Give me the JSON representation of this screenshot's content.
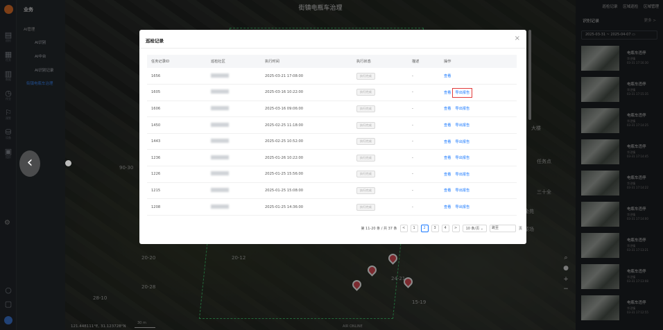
{
  "app": {
    "nav_title": "业务",
    "nav_rail": [
      "巡检",
      "任务",
      "数据",
      "作业",
      "预警",
      "设备",
      "组织",
      "日志"
    ],
    "menu_group": "AI管理",
    "menu_items": [
      "AI识别",
      "AI中台",
      "AI识别记录",
      "街镇电瓶车治理"
    ]
  },
  "map": {
    "title": "街镇电瓶车治理",
    "labels": [
      "90-30",
      "20-12",
      "20-20",
      "20-28",
      "15-19",
      "24-21",
      "28-10",
      "大楼",
      "任务点",
      "三十全",
      "金苑",
      "菜场"
    ],
    "coord": "121.448111°E, 31.123728°N",
    "scale_label": "30 m",
    "credit": "AIR ONLINE"
  },
  "right_panel": {
    "top_links": [
      "巡检记录",
      "区域巡检",
      "区域管理"
    ],
    "title": "识别记录",
    "more": "更多 >",
    "date_start": "2025-03-31",
    "date_end": "2025-04-07",
    "records": [
      {
        "title": "电瓶车违停",
        "sub": "华泾镇",
        "time": "03-31 17:16:30"
      },
      {
        "title": "电瓶车违停",
        "sub": "华泾镇",
        "time": "03-31 17:15:35"
      },
      {
        "title": "电瓶车违停",
        "sub": "华泾镇",
        "time": "03-31 17:14:25"
      },
      {
        "title": "电瓶车违停",
        "sub": "华泾镇",
        "time": "03-31 17:14:45"
      },
      {
        "title": "电瓶车违停",
        "sub": "华泾镇",
        "time": "03-31 17:14:22"
      },
      {
        "title": "电瓶车违停",
        "sub": "华泾镇",
        "time": "03-31 17:14:00"
      },
      {
        "title": "电瓶车违停",
        "sub": "华泾镇",
        "time": "03-31 17:13:21"
      },
      {
        "title": "电瓶车违停",
        "sub": "华泾镇",
        "time": "03-31 17:13:08"
      },
      {
        "title": "电瓶车违停",
        "sub": "华泾镇",
        "time": "03-31 17:12:55"
      }
    ]
  },
  "modal": {
    "title": "巡检记录",
    "close": "×",
    "columns": [
      "任务记录ID",
      "巡检社区",
      "执行时间",
      "执行状态",
      "描述",
      "操作"
    ],
    "rows": [
      {
        "id": "1656",
        "time": "2025-03-21 17:08:00",
        "status": "执行完成",
        "desc": "-",
        "view": "查看",
        "export": ""
      },
      {
        "id": "1605",
        "time": "2025-03-16 10:22:00",
        "status": "执行完成",
        "desc": "-",
        "view": "查看",
        "export": "导出报告"
      },
      {
        "id": "1606",
        "time": "2025-03-16 09:06:00",
        "status": "执行完成",
        "desc": "-",
        "view": "查看",
        "export": "导出报告"
      },
      {
        "id": "1450",
        "time": "2025-02-25 11:18:00",
        "status": "执行完成",
        "desc": "-",
        "view": "查看",
        "export": "导出报告"
      },
      {
        "id": "1443",
        "time": "2025-02-25 10:52:00",
        "status": "执行完成",
        "desc": "-",
        "view": "查看",
        "export": "导出报告"
      },
      {
        "id": "1236",
        "time": "2025-01-26 10:22:00",
        "status": "执行完成",
        "desc": "-",
        "view": "查看",
        "export": "导出报告"
      },
      {
        "id": "1226",
        "time": "2025-01-25 15:56:00",
        "status": "执行完成",
        "desc": "-",
        "view": "查看",
        "export": "导出报告"
      },
      {
        "id": "1215",
        "time": "2025-01-25 15:08:00",
        "status": "执行完成",
        "desc": "-",
        "view": "查看",
        "export": "导出报告"
      },
      {
        "id": "1208",
        "time": "2025-01-25 14:36:00",
        "status": "执行完成",
        "desc": "-",
        "view": "查看",
        "export": "导出报告"
      }
    ],
    "pager": {
      "summary": "第 11-20 条 / 共 37 条",
      "prev": "<",
      "pages": [
        "1",
        "2",
        "3",
        "4"
      ],
      "current": "2",
      "next": ">",
      "page_size": "10 条/页",
      "jump_label": "跳至",
      "page_suffix": "页"
    }
  },
  "colors": {
    "accent": "#1677ff",
    "highlight": "#e23a3a",
    "pin": "#e14d57",
    "boundary": "#3fbf6a"
  }
}
